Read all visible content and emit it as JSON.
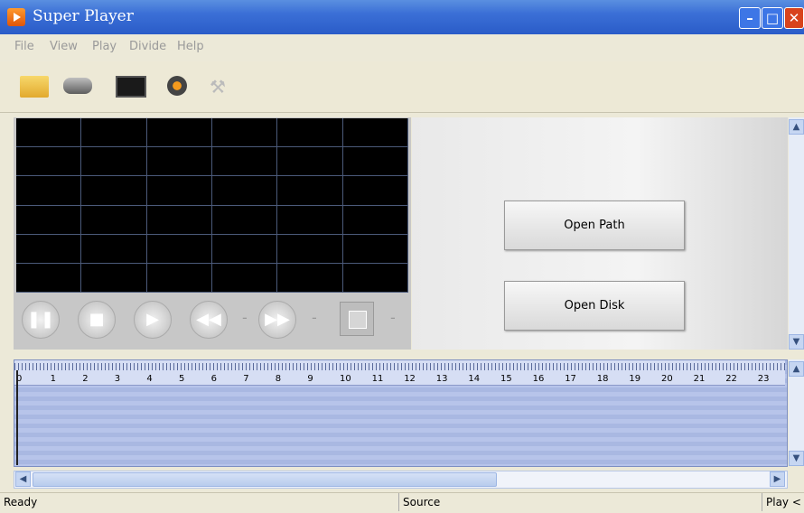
{
  "window": {
    "title": "Super Player",
    "minimize": "–",
    "maximize": "□",
    "close": "✕"
  },
  "menu": [
    {
      "label": "File"
    },
    {
      "label": "View"
    },
    {
      "label": "Play"
    },
    {
      "label": "Divide"
    },
    {
      "label": "Help"
    }
  ],
  "toolbar": {
    "icons": [
      "folder-icon",
      "drive-icon",
      "monitor-icon",
      "settings-icon",
      "tools-icon"
    ]
  },
  "controls": {
    "pause": "❚❚",
    "stop": "■",
    "play": "▶",
    "rewind": "◀◀",
    "forward": "▶▶",
    "dash": "-"
  },
  "buttons": {
    "open_path": "Open Path",
    "open_disk": "Open Disk"
  },
  "timeline": {
    "ticks": [
      "0",
      "1",
      "2",
      "3",
      "4",
      "5",
      "6",
      "7",
      "8",
      "9",
      "10",
      "11",
      "12",
      "13",
      "14",
      "15",
      "16",
      "17",
      "18",
      "19",
      "20",
      "21",
      "22",
      "23"
    ]
  },
  "scroll": {
    "up": "▲",
    "down": "▼",
    "left": "◀",
    "right": "▶"
  },
  "status": {
    "left": "Ready",
    "middle": "Source",
    "right": "Play <"
  },
  "colors": {
    "titlebar": "#3b6fd6",
    "timeline": "#a9b8e2",
    "close": "#d8431c"
  }
}
